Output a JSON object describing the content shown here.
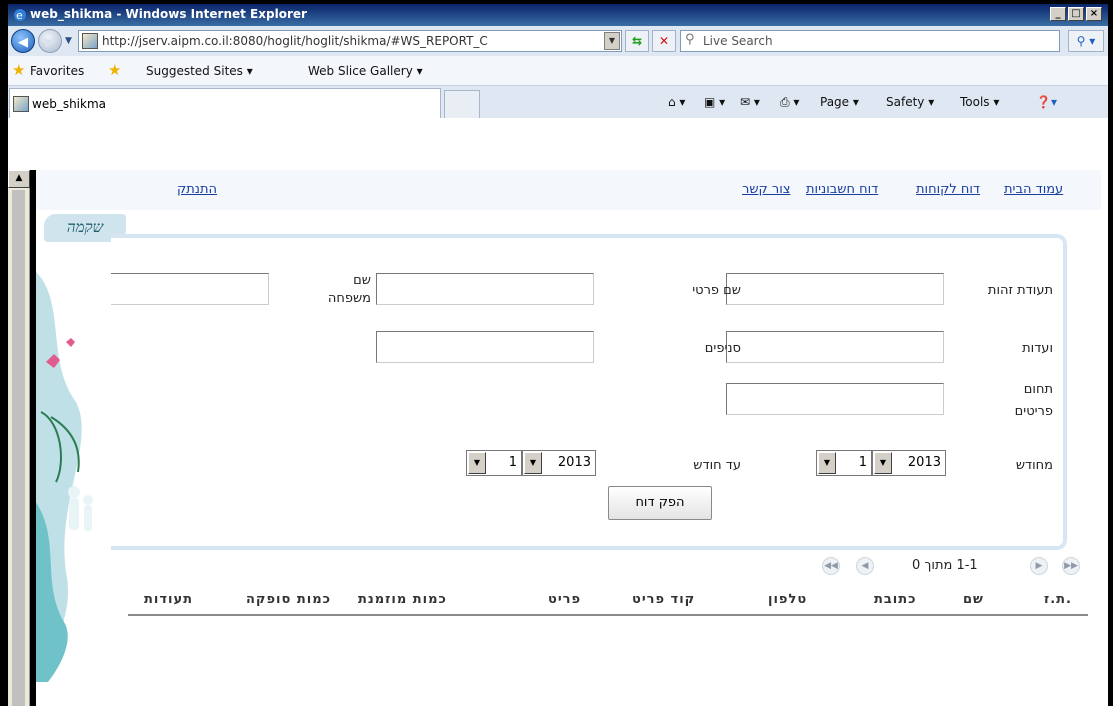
{
  "window": {
    "title": "web_shikma - Windows Internet Explorer",
    "min": "_",
    "max": "□",
    "close": "×"
  },
  "toolbar": {
    "address": "http://jserv.aipm.co.il:8080/hoglit/hoglit/shikma/#WS_REPORT_C",
    "search_placeholder": "Live Search"
  },
  "favorites": {
    "favorites_label": "Favorites",
    "suggested_sites": "Suggested Sites ▾",
    "web_slice_gallery": "Web Slice Gallery ▾"
  },
  "tabs": {
    "active_title": "web_shikma"
  },
  "commandbar": {
    "page": "Page ▾",
    "safety": "Safety ▾",
    "tools": "Tools ▾"
  },
  "nav": {
    "home": "עמוד הבית",
    "customers_report": "דוח לקוחות",
    "invoices_report": "דוח חשבוניות",
    "contact": "צור קשר",
    "logout": "התנתק"
  },
  "logo": "שקמה",
  "form": {
    "id_label": "תעודת זהות",
    "first_name_label": "שם פרטי",
    "last_name_label_1": "שם",
    "last_name_label_2": "משפחה",
    "committees_label": "ועדות",
    "branches_label": "סניפים",
    "items_domain_label_1": "תחום",
    "items_domain_label_2": "פריטים",
    "from_month_label": "מחודש",
    "to_month_label": "עד חודש",
    "from_year": "2013",
    "from_month": "1",
    "to_year": "2013",
    "to_month": "1",
    "generate_button": "הפק דוח"
  },
  "pager": {
    "text": "1-1 מתוך 0"
  },
  "grid": {
    "columns": [
      "ת.ז.",
      "שם",
      "כתובת",
      "טלפון",
      "קוד פריט",
      "פריט",
      "כמות מוזמנת",
      "כמות סופקה",
      "תעודות"
    ]
  }
}
